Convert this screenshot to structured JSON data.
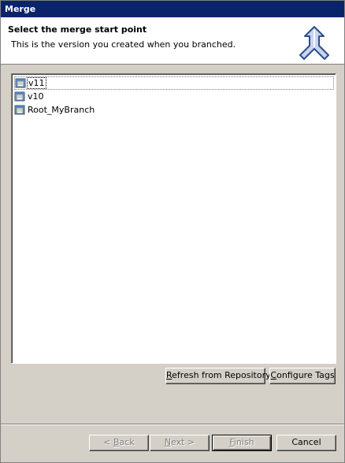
{
  "window": {
    "title": "Merge"
  },
  "banner": {
    "title": "Select the merge start point",
    "description": "This is the version you created when you branched.",
    "icon": "merge-arrows-icon"
  },
  "tags": {
    "items": [
      {
        "label": "v11",
        "icon": "version-tag-icon",
        "selected": true
      },
      {
        "label": "v10",
        "icon": "version-tag-icon",
        "selected": false
      },
      {
        "label": "Root_MyBranch",
        "icon": "branch-tag-icon",
        "selected": false
      }
    ]
  },
  "actions": {
    "refresh_pre": "",
    "refresh_key": "R",
    "refresh_post": "efresh from Repository",
    "configure_pre": "",
    "configure_key": "C",
    "configure_post": "onfigure Tags"
  },
  "footer": {
    "back_pre": "< ",
    "back_key": "B",
    "back_post": "ack",
    "next_pre": "",
    "next_key": "N",
    "next_post": "ext >",
    "finish_pre": "",
    "finish_key": "F",
    "finish_post": "inish",
    "cancel_label": "Cancel",
    "back_enabled": false,
    "next_enabled": false,
    "finish_enabled": false
  },
  "colors": {
    "titlebar": "#0a246a",
    "dialog_bg": "#d4d0c8",
    "banner_bg": "#ffffff"
  }
}
